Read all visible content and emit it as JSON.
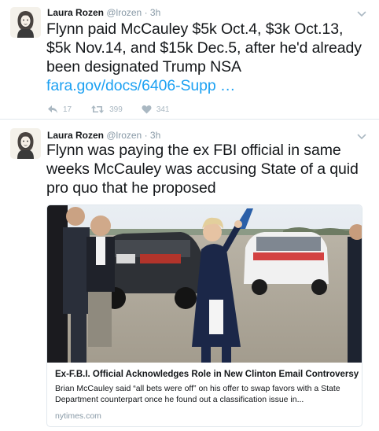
{
  "tweets": [
    {
      "author_name": "Laura Rozen",
      "author_handle": "@lrozen",
      "timestamp": "3h",
      "text": "Flynn paid McCauley $5k Oct.4, $3k Oct.13, $5k Nov.14, and $15k Dec.5, after he'd already been designated Trump NSA",
      "link_text": "fara.gov/docs/6406-Supp …",
      "replies": "17",
      "retweets": "399",
      "likes": "341"
    },
    {
      "author_name": "Laura Rozen",
      "author_handle": "@lrozen",
      "timestamp": "3h",
      "text": "Flynn was paying the ex FBI official in same weeks McCauley was accusing State of a quid pro quo that he proposed",
      "card": {
        "title": "Ex-F.B.I. Official Acknowledges Role in New Clinton Email Controversy",
        "description": "Brian McCauley said “all bets were off” on his offer to swap favors with a State Department counterpart once he found out a classification issue in...",
        "domain": "nytimes.com"
      }
    }
  ],
  "colors": {
    "text": "#14171a",
    "muted": "#8899a6",
    "link": "#1da1f2",
    "action_icons": "#aab8c2",
    "border": "#e1e8ed"
  },
  "icons": [
    "chevron-down-icon",
    "reply-icon",
    "retweet-icon",
    "heart-icon"
  ]
}
